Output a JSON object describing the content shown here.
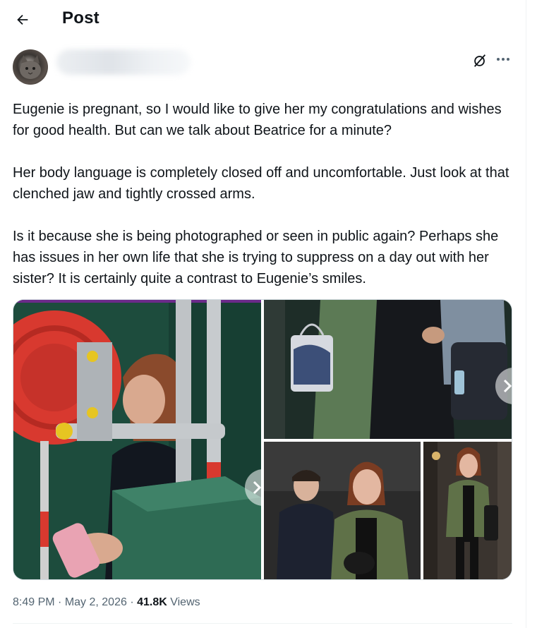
{
  "header": {
    "title": "Post",
    "back_icon": "arrow-left-icon"
  },
  "author": {
    "avatar_icon": "avatar-cat",
    "name_blurred": true
  },
  "actions": {
    "grok_icon": "grok-icon",
    "more_icon": "more-horizontal-icon"
  },
  "post": {
    "paragraphs": [
      "Eugenie is pregnant, so I would like to give her my congratulations and wishes for good health. But can we talk about Beatrice for a minute?",
      "Her body language is completely closed off and uncomfortable. Just look at that clenched jaw and tightly crossed arms.",
      "Is it because she is being photographed or seen in public again? Perhaps she has issues in her own life that she is trying to suppress on a day out with her sister? It is certainly quite a contrast to Eugenie’s smiles."
    ],
    "image_count": 4
  },
  "meta": {
    "time": "8:49 PM",
    "separator": " · ",
    "date": "May 2, 2026",
    "views_count": "41.8K",
    "views_label": " Views"
  },
  "colors": {
    "text": "#0f1419",
    "secondary": "#536471",
    "border": "#cfd9de"
  }
}
